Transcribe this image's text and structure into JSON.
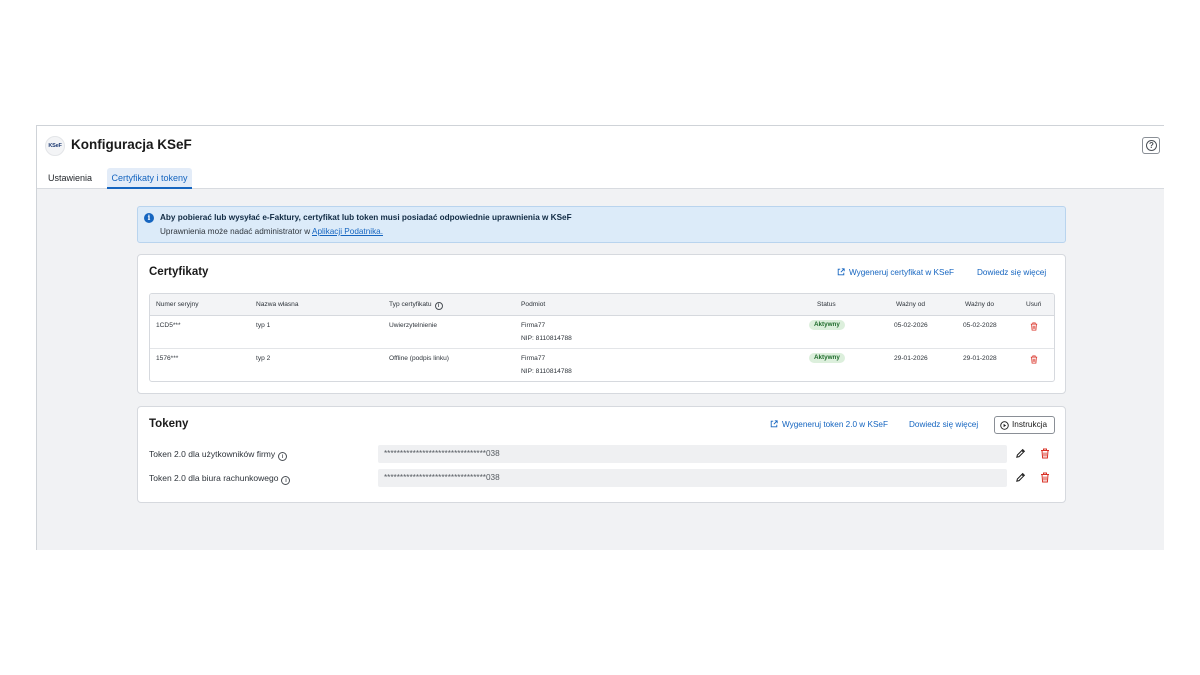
{
  "app": {
    "logo_text": "KSeF",
    "title": "Konfiguracja KSeF"
  },
  "tabs": [
    {
      "label": "Ustawienia",
      "active": false
    },
    {
      "label": "Certyfikaty i tokeny",
      "active": true
    }
  ],
  "alert": {
    "title": "Aby pobierać lub wysyłać e-Faktury, certyfikat lub token musi posiadać odpowiednie uprawnienia w KSeF",
    "text_before": "Uprawnienia może nadać administrator w ",
    "link": "Aplikacji Podatnika."
  },
  "certificates": {
    "title": "Certyfikaty",
    "generate_label": "Wygeneruj certyfikat w KSeF",
    "learn_more_label": "Dowiedz się więcej",
    "columns": [
      "Numer seryjny",
      "Nazwa własna",
      "Typ certyfikatu",
      "Podmiot",
      "Status",
      "Ważny od",
      "Ważny do",
      "Usuń"
    ],
    "rows": [
      {
        "serial": "1CD5***",
        "name": "typ 1",
        "type": "Uwierzytelnienie",
        "entity": "Firma77",
        "nip": "NIP: 8110814788",
        "status": "Aktywny",
        "valid_from": "05-02-2026",
        "valid_to": "05-02-2028"
      },
      {
        "serial": "1576***",
        "name": "typ 2",
        "type": "Offline (podpis linku)",
        "entity": "Firma77",
        "nip": "NIP: 8110814788",
        "status": "Aktywny",
        "valid_from": "29-01-2026",
        "valid_to": "29-01-2028"
      }
    ]
  },
  "tokens": {
    "title": "Tokeny",
    "generate_label": "Wygeneruj token 2.0 w KSeF",
    "learn_more_label": "Dowiedz się więcej",
    "instruction_label": "Instrukcja",
    "items": [
      {
        "label": "Token 2.0 dla użytkowników firmy",
        "value": "********************************038"
      },
      {
        "label": "Token 2.0 dla biura rachunkowego",
        "value": "********************************038"
      }
    ]
  },
  "colors": {
    "accent": "#1565c0",
    "danger": "#d93025",
    "success_bg": "#dcefdc",
    "alert_bg": "#dcebf9"
  }
}
